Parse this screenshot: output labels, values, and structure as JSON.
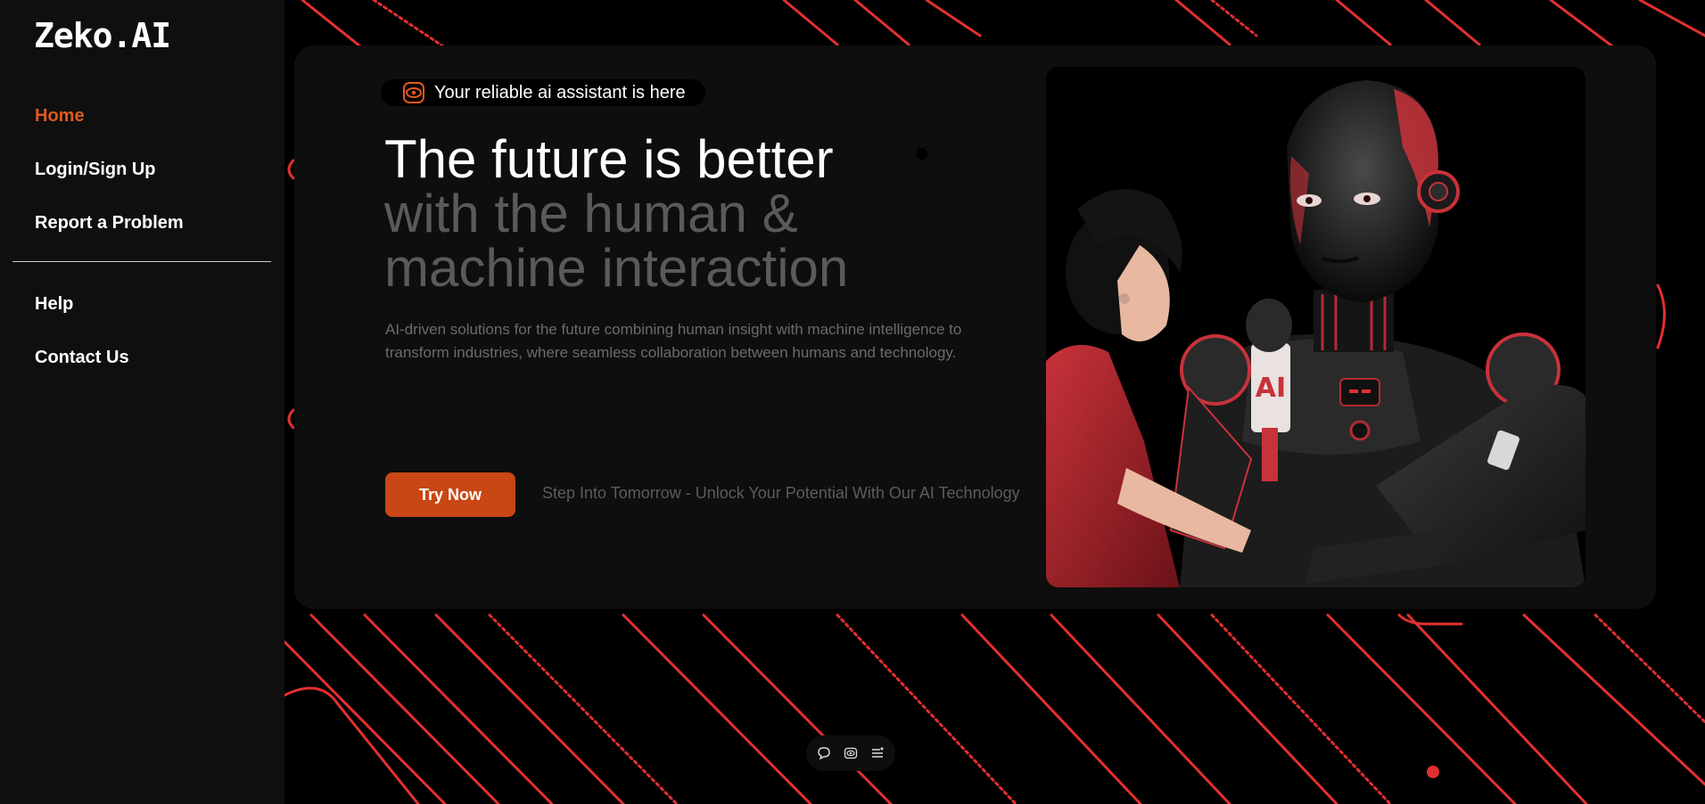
{
  "brand": {
    "logo": "Zeko.AI",
    "accent": "#e05a1f"
  },
  "sidebar": {
    "items": [
      {
        "label": "Home",
        "active": true
      },
      {
        "label": "Login/Sign Up"
      },
      {
        "label": "Report a Problem"
      },
      {
        "label": "Help"
      },
      {
        "label": "Contact Us"
      }
    ]
  },
  "hero": {
    "badge": "Your reliable ai assistant is here",
    "headline_line1": "The future is better",
    "headline_line2": "with the human &",
    "headline_line3": "machine interaction",
    "description": "AI-driven solutions for the future combining human insight with machine intelligence to transform industries, where seamless collaboration between humans and technology.",
    "cta": "Try Now",
    "tagline": "Step Into Tomorrow - Unlock Your Potential With Our AI Technology",
    "image_badge": "AI"
  },
  "toolbar": {
    "icons": [
      "chat-icon",
      "eye-icon",
      "list-icon"
    ]
  }
}
